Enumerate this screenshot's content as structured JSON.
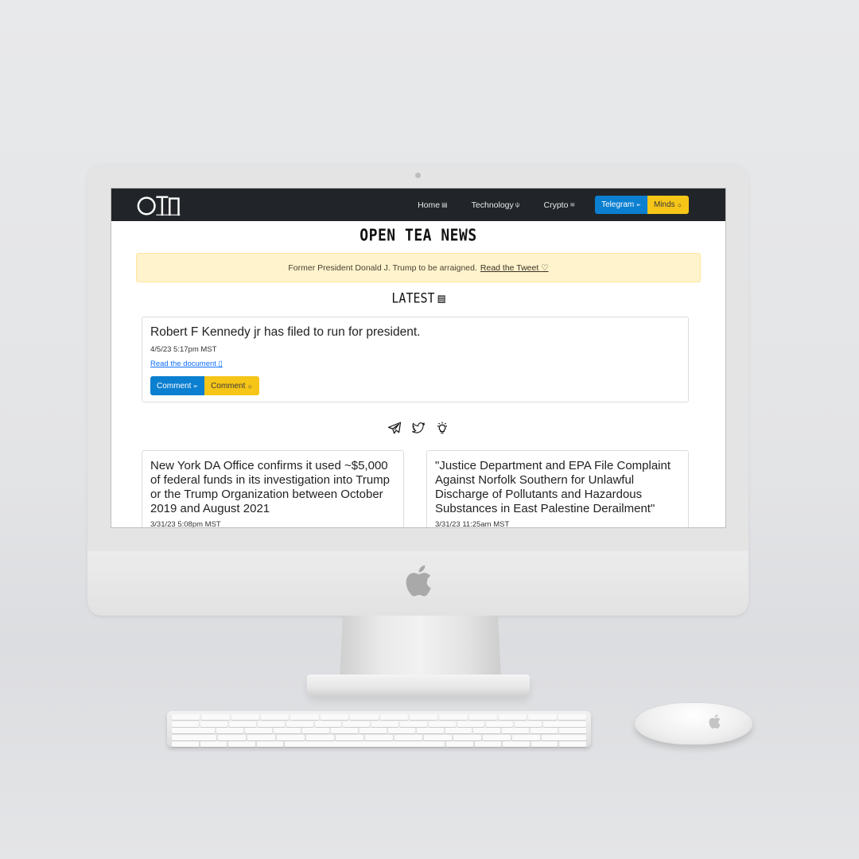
{
  "navbar": {
    "brand": "OTN",
    "links": [
      {
        "label": "Home",
        "icon": "newspaper-icon"
      },
      {
        "label": "Technology",
        "icon": "usb-icon"
      },
      {
        "label": "Crypto",
        "icon": "coin-icon"
      }
    ],
    "telegram_label": "Telegram",
    "minds_label": "Minds"
  },
  "site_title": "OPEN TEA NEWS",
  "alert": {
    "text": "Former President Donald J. Trump to be arraigned.",
    "link_text": "Read the Tweet"
  },
  "latest_heading": "LATEST",
  "main_card": {
    "title": "Robert F Kennedy jr has filed to run for president.",
    "date": "4/5/23 5:17pm MST",
    "link_text": "Read the document",
    "comment_telegram": "Comment",
    "comment_minds": "Comment"
  },
  "social_icons": [
    "telegram-icon",
    "twitter-icon",
    "lightbulb-icon"
  ],
  "cards": [
    {
      "title": "New York DA Office confirms it used ~$5,000 of federal funds in its investigation into Trump or the Trump Organization between October 2019 and August 2021",
      "date": "3/31/23 5:08pm MST"
    },
    {
      "title": "\"Justice Department and EPA File Complaint Against Norfolk Southern for Unlawful Discharge of Pollutants and Hazardous Substances in East Palestine Derailment\"",
      "date": "3/31/23 11:25am MST"
    }
  ],
  "colors": {
    "navbar": "#212529",
    "telegram_blue": "#0b7fd0",
    "minds_yellow": "#f5c518",
    "alert_bg": "#fff3cd"
  }
}
